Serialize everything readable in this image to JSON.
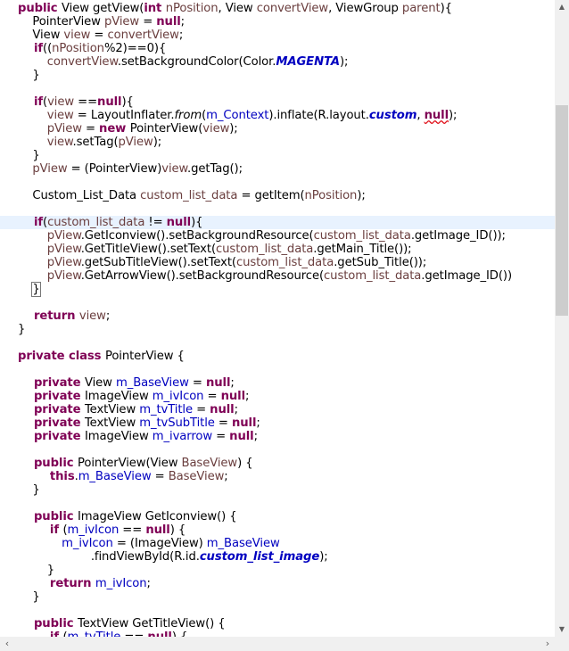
{
  "code_lines": [
    [
      [
        "kw",
        "public "
      ],
      [
        "",
        "View getView("
      ],
      [
        "kw",
        "int "
      ],
      [
        "var",
        "nPosition"
      ],
      [
        "",
        ", View "
      ],
      [
        "var",
        "convertView"
      ],
      [
        "",
        ", ViewGroup "
      ],
      [
        "var",
        "parent"
      ],
      [
        "",
        "){"
      ]
    ],
    [
      [
        "",
        "    PointerView "
      ],
      [
        "var",
        "pView"
      ],
      [
        "",
        " = "
      ],
      [
        "kw",
        "null"
      ],
      [
        "",
        ";"
      ]
    ],
    [
      [
        "",
        "    View "
      ],
      [
        "var",
        "view"
      ],
      [
        "",
        " = "
      ],
      [
        "var",
        "convertView"
      ],
      [
        "",
        ";"
      ]
    ],
    [
      [
        "kw",
        "    if"
      ],
      [
        "",
        "(("
      ],
      [
        "var",
        "nPosition"
      ],
      [
        "",
        "%2)==0){"
      ]
    ],
    [
      [
        "var",
        "        convertView"
      ],
      [
        "",
        ".setBackgroundColor(Color."
      ],
      [
        "cst",
        "MAGENTA"
      ],
      [
        "",
        ");"
      ]
    ],
    [
      [
        "",
        "    }"
      ]
    ],
    [],
    [
      [
        "kw",
        "    if"
      ],
      [
        "",
        "("
      ],
      [
        "var",
        "view"
      ],
      [
        "",
        " =="
      ],
      [
        "kw",
        "null"
      ],
      [
        "",
        "){"
      ]
    ],
    [
      [
        "var",
        "        view"
      ],
      [
        "",
        " = LayoutInflater."
      ],
      [
        "sm",
        "from"
      ],
      [
        "",
        "("
      ],
      [
        "fld",
        "m_Context"
      ],
      [
        "",
        ").inflate(R.layout."
      ],
      [
        "cst",
        "custom"
      ],
      [
        "",
        ", "
      ],
      [
        "kw err",
        "null"
      ],
      [
        "",
        ");"
      ]
    ],
    [
      [
        "var",
        "        pView"
      ],
      [
        "",
        " = "
      ],
      [
        "kw",
        "new "
      ],
      [
        "",
        "PointerView("
      ],
      [
        "var",
        "view"
      ],
      [
        "",
        ");"
      ]
    ],
    [
      [
        "var",
        "        view"
      ],
      [
        "",
        ".setTag("
      ],
      [
        "var",
        "pView"
      ],
      [
        "",
        ");"
      ]
    ],
    [
      [
        "",
        "    }"
      ]
    ],
    [
      [
        "var",
        "    pView"
      ],
      [
        "",
        " = (PointerView)"
      ],
      [
        "var",
        "view"
      ],
      [
        "",
        ".getTag();"
      ]
    ],
    [],
    [
      [
        "",
        "    Custom_List_Data "
      ],
      [
        "var",
        "custom_list_data"
      ],
      [
        "",
        " = getItem("
      ],
      [
        "var",
        "nPosition"
      ],
      [
        "",
        ");"
      ]
    ],
    [],
    [
      [
        "kw",
        "    if"
      ],
      [
        "",
        "("
      ],
      [
        "var",
        "custom_list_data"
      ],
      [
        "",
        " != "
      ],
      [
        "kw",
        "null"
      ],
      [
        "",
        "){"
      ]
    ],
    [
      [
        "var",
        "        pView"
      ],
      [
        "",
        ".GetIconview().setBackgroundResource("
      ],
      [
        "var",
        "custom_list_data"
      ],
      [
        "",
        ".getImage_ID());"
      ]
    ],
    [
      [
        "var",
        "        pView"
      ],
      [
        "",
        ".GetTitleView().setText("
      ],
      [
        "var",
        "custom_list_data"
      ],
      [
        "",
        ".getMain_Title());"
      ]
    ],
    [
      [
        "var",
        "        pView"
      ],
      [
        "",
        ".getSubTitleView().setText("
      ],
      [
        "var",
        "custom_list_data"
      ],
      [
        "",
        ".getSub_Title());"
      ]
    ],
    [
      [
        "var",
        "        pView"
      ],
      [
        "",
        ".GetArrowView().setBackgroundResource("
      ],
      [
        "var",
        "custom_list_data"
      ],
      [
        "",
        ".getImage_ID())"
      ]
    ],
    [
      [
        "",
        "    "
      ],
      [
        "caret",
        "}"
      ]
    ],
    [],
    [
      [
        "kw",
        "    return "
      ],
      [
        "var",
        "view"
      ],
      [
        "",
        ";"
      ]
    ],
    [
      [
        "",
        "}"
      ]
    ],
    [],
    [
      [
        "kw",
        "private class "
      ],
      [
        "",
        "PointerView {"
      ]
    ],
    [],
    [
      [
        "kw",
        "    private "
      ],
      [
        "",
        "View "
      ],
      [
        "fld",
        "m_BaseView"
      ],
      [
        "",
        " = "
      ],
      [
        "kw",
        "null"
      ],
      [
        "",
        ";"
      ]
    ],
    [
      [
        "kw",
        "    private "
      ],
      [
        "",
        "ImageView "
      ],
      [
        "fld",
        "m_ivIcon"
      ],
      [
        "",
        " = "
      ],
      [
        "kw",
        "null"
      ],
      [
        "",
        ";"
      ]
    ],
    [
      [
        "kw",
        "    private "
      ],
      [
        "",
        "TextView "
      ],
      [
        "fld",
        "m_tvTitle"
      ],
      [
        "",
        " = "
      ],
      [
        "kw",
        "null"
      ],
      [
        "",
        ";"
      ]
    ],
    [
      [
        "kw",
        "    private "
      ],
      [
        "",
        "TextView "
      ],
      [
        "fld",
        "m_tvSubTitle"
      ],
      [
        "",
        " = "
      ],
      [
        "kw",
        "null"
      ],
      [
        "",
        ";"
      ]
    ],
    [
      [
        "kw",
        "    private "
      ],
      [
        "",
        "ImageView "
      ],
      [
        "fld",
        "m_ivarrow"
      ],
      [
        "",
        " = "
      ],
      [
        "kw",
        "null"
      ],
      [
        "",
        ";"
      ]
    ],
    [],
    [
      [
        "kw",
        "    public "
      ],
      [
        "",
        "PointerView(View "
      ],
      [
        "var",
        "BaseView"
      ],
      [
        "",
        ") {"
      ]
    ],
    [
      [
        "kw",
        "        this"
      ],
      [
        "",
        "."
      ],
      [
        "fld",
        "m_BaseView"
      ],
      [
        "",
        " = "
      ],
      [
        "var",
        "BaseView"
      ],
      [
        "",
        ";"
      ]
    ],
    [
      [
        "",
        "    }"
      ]
    ],
    [],
    [
      [
        "kw",
        "    public "
      ],
      [
        "",
        "ImageView GetIconview() {"
      ]
    ],
    [
      [
        "kw",
        "        if "
      ],
      [
        "",
        "("
      ],
      [
        "fld",
        "m_ivIcon"
      ],
      [
        "",
        " == "
      ],
      [
        "kw",
        "null"
      ],
      [
        "",
        ") {"
      ]
    ],
    [
      [
        "fld",
        "            m_ivIcon"
      ],
      [
        "",
        " = (ImageView) "
      ],
      [
        "fld",
        "m_BaseView"
      ]
    ],
    [
      [
        "",
        "                    .findViewById(R.id."
      ],
      [
        "cst",
        "custom_list_image"
      ],
      [
        "",
        ");"
      ]
    ],
    [
      [
        "",
        "        }"
      ]
    ],
    [
      [
        "kw",
        "        return "
      ],
      [
        "fld",
        "m_ivIcon"
      ],
      [
        "",
        ";"
      ]
    ],
    [
      [
        "",
        "    }"
      ]
    ],
    [],
    [
      [
        "kw",
        "    public "
      ],
      [
        "",
        "TextView GetTitleView() {"
      ]
    ],
    [
      [
        "kw",
        "        if "
      ],
      [
        "",
        "("
      ],
      [
        "fld",
        "m_tvTitle"
      ],
      [
        "",
        " == "
      ],
      [
        "kw",
        "null"
      ],
      [
        "",
        ") {"
      ]
    ]
  ],
  "highlighted_line": 16,
  "scroll": {
    "up_arrow": "▲",
    "down_arrow": "▼",
    "left_arrow": "‹",
    "right_arrow": "›"
  }
}
